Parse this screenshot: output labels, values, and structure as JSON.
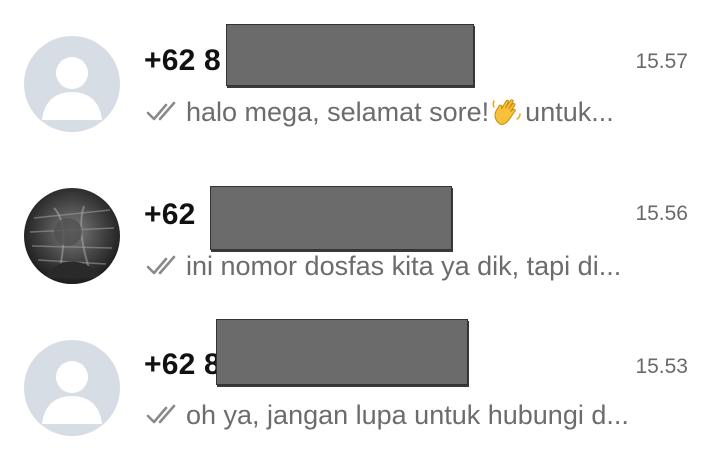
{
  "chats": [
    {
      "name": "+62 8",
      "time": "15.57",
      "preview_before": "halo mega, selamat sore!",
      "preview_emoji": "waving-hand-emoji",
      "preview_after": " untuk...",
      "avatar": "default-person-avatar",
      "status": "read-double-check-icon"
    },
    {
      "name": "+62",
      "time": "15.56",
      "preview": "ini nomor dosfas kita ya dik, tapi di...",
      "avatar": "photo-avatar",
      "status": "read-double-check-icon"
    },
    {
      "name": "+62 8",
      "time": "15.53",
      "preview": "oh ya, jangan lupa untuk hubungi d...",
      "avatar": "default-person-avatar",
      "status": "read-double-check-icon"
    }
  ],
  "colors": {
    "avatar_bg": "#d6dde5",
    "avatar_fg": "#ffffff",
    "tick": "#8a8a8a",
    "redaction": "#6b6b6b"
  }
}
